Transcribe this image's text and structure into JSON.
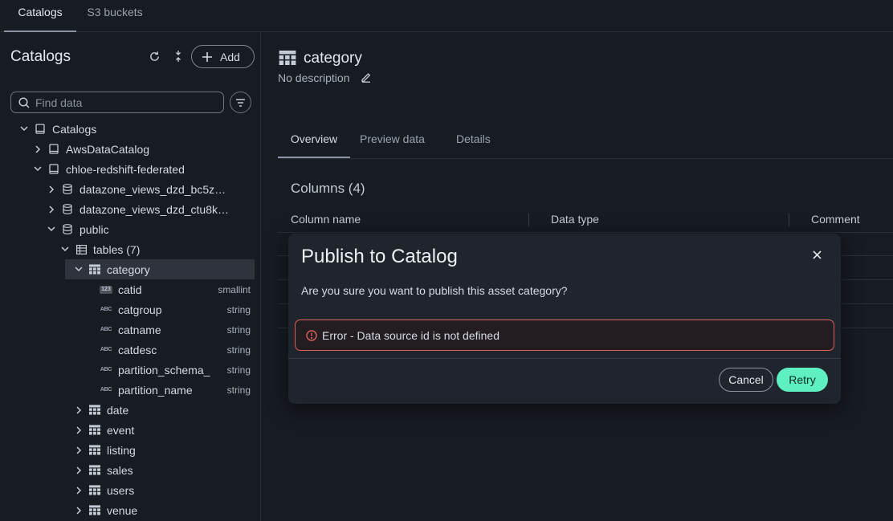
{
  "top_tabs": {
    "catalogs": "Catalogs",
    "s3": "S3 buckets"
  },
  "sidebar": {
    "title": "Catalogs",
    "add_label": "Add",
    "search_placeholder": "Find data",
    "tree": {
      "root": "Catalogs",
      "aws": "AwsDataCatalog",
      "federated": "chloe-redshift-federated",
      "view1": "datazone_views_dzd_bc5z…",
      "view2": "datazone_views_dzd_ctu8k…",
      "public": "public",
      "tables": "tables (7)",
      "category": "category",
      "columns": [
        {
          "name": "catid",
          "type": "smallint"
        },
        {
          "name": "catgroup",
          "type": "string"
        },
        {
          "name": "catname",
          "type": "string"
        },
        {
          "name": "catdesc",
          "type": "string"
        },
        {
          "name": "partition_schema_",
          "type": "string"
        },
        {
          "name": "partition_name",
          "type": "string"
        }
      ],
      "other_tables": [
        "date",
        "event",
        "listing",
        "sales",
        "users",
        "venue"
      ]
    }
  },
  "main": {
    "title": "category",
    "description": "No description",
    "tabs": [
      "Overview",
      "Preview data",
      "Details"
    ],
    "columns_title": "Columns (4)",
    "headers": [
      "Column name",
      "Data type",
      "Comment"
    ]
  },
  "modal": {
    "title": "Publish to Catalog",
    "message": "Are you sure you want to publish this asset category?",
    "error": "Error - Data source id is not defined",
    "cancel": "Cancel",
    "retry": "Retry"
  },
  "colors": {
    "accent": "#5ef0c0",
    "error": "#e0605a",
    "background": "#171b22",
    "modal": "#20252d"
  }
}
